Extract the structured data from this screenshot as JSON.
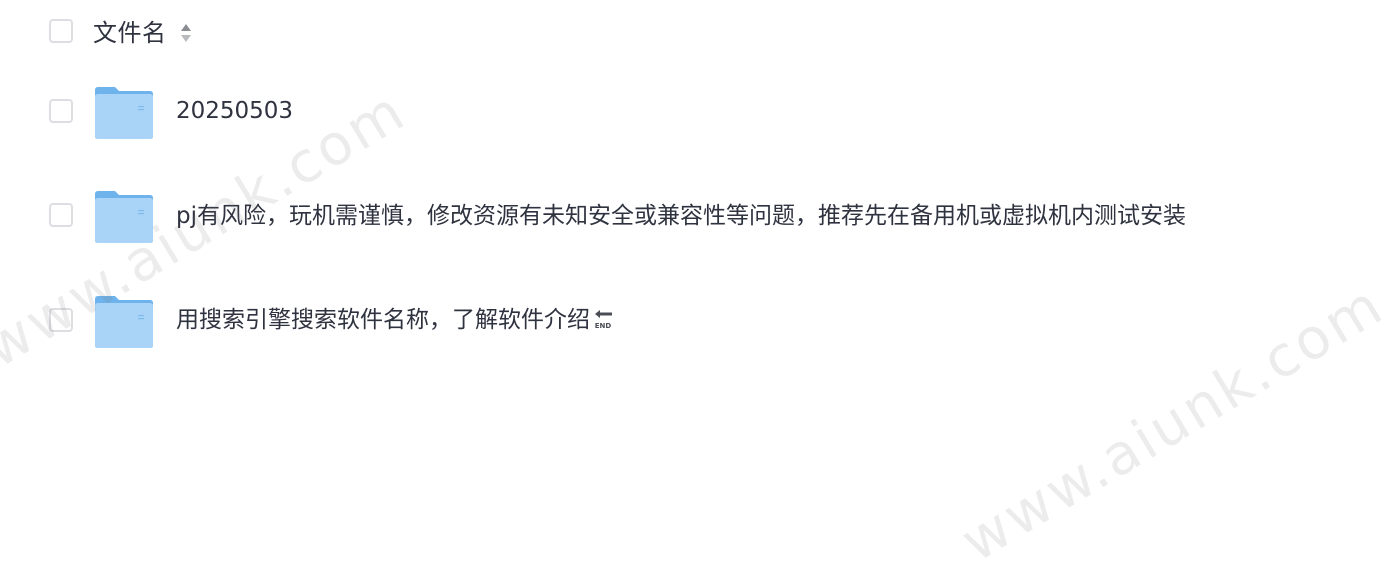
{
  "header": {
    "column_label": "文件名",
    "sort_icon": "sort-updown-icon"
  },
  "rows": [
    {
      "name": "20250503",
      "icon": "folder-icon"
    },
    {
      "name": "pj有风险，玩机需谨慎，修改资源有未知安全或兼容性等问题，推荐先在备用机或虚拟机内测试安装",
      "icon": "folder-icon"
    },
    {
      "name": "用搜索引擎搜索软件名称，了解软件介绍",
      "icon": "folder-icon",
      "suffix_icon": "end-arrow-icon",
      "suffix_text": "END"
    }
  ],
  "watermarks": [
    "www.aiunk.com",
    "www.aiunk.com"
  ],
  "colors": {
    "folder_light": "#a9d4f7",
    "folder_dark": "#6fb3ec",
    "text": "#2f3340",
    "checkbox_border": "#dcdee2"
  }
}
